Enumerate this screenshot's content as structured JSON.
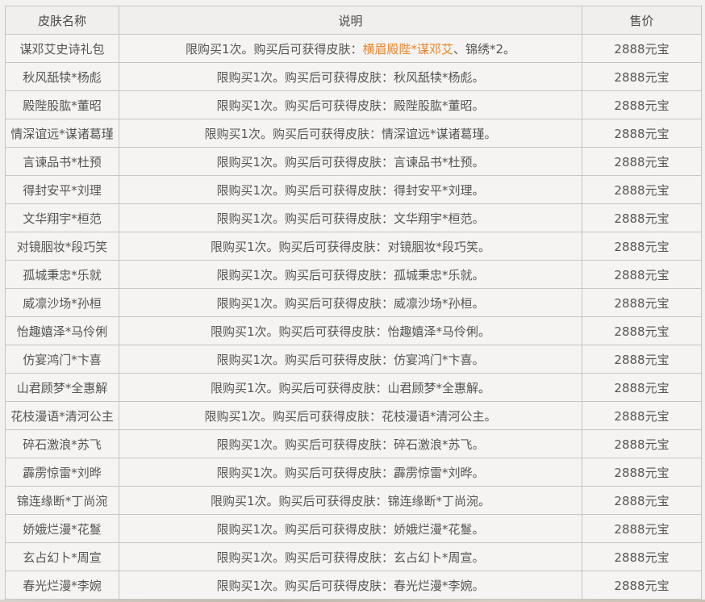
{
  "table": {
    "headers": [
      "皮肤名称",
      "说明",
      "售价"
    ],
    "rows": [
      {
        "name": "谋邓艾史诗礼包",
        "desc_prefix": "限购买1次。购买后可获得皮肤：",
        "desc_highlight": "横眉殿陛*谋邓艾",
        "desc_suffix": "、锦绣*2。",
        "price": "2888元宝"
      },
      {
        "name": "秋风舐犊*杨彪",
        "desc": "限购买1次。购买后可获得皮肤：秋风舐犊*杨彪。",
        "price": "2888元宝"
      },
      {
        "name": "殿陛股肱*董昭",
        "desc": "限购买1次。购买后可获得皮肤：殿陛股肱*董昭。",
        "price": "2888元宝"
      },
      {
        "name": "情深谊远*谋诸葛瑾",
        "desc": "限购买1次。购买后可获得皮肤：情深谊远*谋诸葛瑾。",
        "price": "2888元宝"
      },
      {
        "name": "言谏品书*杜预",
        "desc": "限购买1次。购买后可获得皮肤：言谏品书*杜预。",
        "price": "2888元宝"
      },
      {
        "name": "得封安平*刘理",
        "desc": "限购买1次。购买后可获得皮肤：得封安平*刘理。",
        "price": "2888元宝"
      },
      {
        "name": "文华翔宇*桓范",
        "desc": "限购买1次。购买后可获得皮肤：文华翔宇*桓范。",
        "price": "2888元宝"
      },
      {
        "name": "对镜胭妆*段巧笑",
        "desc": "限购买1次。购买后可获得皮肤：对镜胭妆*段巧笑。",
        "price": "2888元宝"
      },
      {
        "name": "孤城秉忠*乐就",
        "desc": "限购买1次。购买后可获得皮肤：孤城秉忠*乐就。",
        "price": "2888元宝"
      },
      {
        "name": "威凛沙场*孙桓",
        "desc": "限购买1次。购买后可获得皮肤：威凛沙场*孙桓。",
        "price": "2888元宝"
      },
      {
        "name": "怡趣嬉泽*马伶俐",
        "desc": "限购买1次。购买后可获得皮肤：怡趣嬉泽*马伶俐。",
        "price": "2888元宝"
      },
      {
        "name": "仿宴鸿门*卞喜",
        "desc": "限购买1次。购买后可获得皮肤：仿宴鸿门*卞喜。",
        "price": "2888元宝"
      },
      {
        "name": "山君顾梦*全惠解",
        "desc": "限购买1次。购买后可获得皮肤：山君顾梦*全惠解。",
        "price": "2888元宝"
      },
      {
        "name": "花枝漫语*清河公主",
        "desc": "限购买1次。购买后可获得皮肤：花枝漫语*清河公主。",
        "price": "2888元宝"
      },
      {
        "name": "碎石激浪*苏飞",
        "desc": "限购买1次。购买后可获得皮肤：碎石激浪*苏飞。",
        "price": "2888元宝"
      },
      {
        "name": "霹雳惊雷*刘晔",
        "desc": "限购买1次。购买后可获得皮肤：霹雳惊雷*刘晔。",
        "price": "2888元宝"
      },
      {
        "name": "锦连缘断*丁尚涴",
        "desc": "限购买1次。购买后可获得皮肤：锦连缘断*丁尚涴。",
        "price": "2888元宝"
      },
      {
        "name": "娇娥烂漫*花鬘",
        "desc": "限购买1次。购买后可获得皮肤：娇娥烂漫*花鬘。",
        "price": "2888元宝"
      },
      {
        "name": "玄占幻卜*周宣",
        "desc": "限购买1次。购买后可获得皮肤：玄占幻卜*周宣。",
        "price": "2888元宝"
      },
      {
        "name": "春光烂漫*李婉",
        "desc": "限购买1次。购买后可获得皮肤：春光烂漫*李婉。",
        "price": "2888元宝"
      }
    ]
  },
  "colors": {
    "text": "#555555",
    "highlight": "#e7862c",
    "border": "#c9c5c1",
    "background": "#f5f4f2"
  }
}
